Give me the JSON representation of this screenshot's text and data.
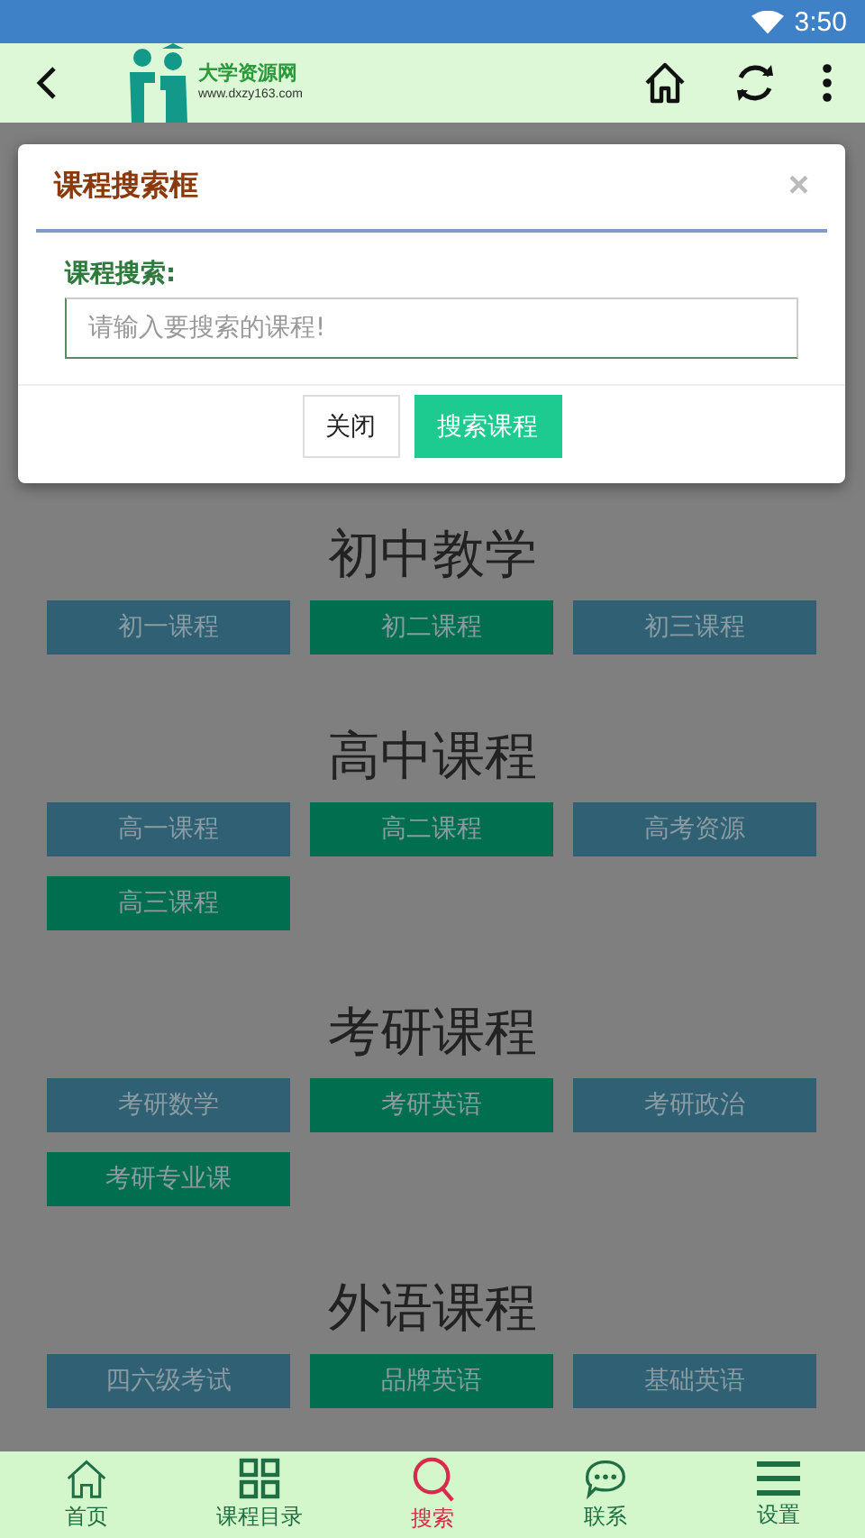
{
  "status_bar": {
    "time": "3:50"
  },
  "app_bar": {
    "logo_title": "大学资源网",
    "logo_url": "www.dxzy163.com"
  },
  "sections": [
    {
      "heading": "初中教学",
      "buttons": [
        {
          "label": "初一课程",
          "color": "#2f6073"
        },
        {
          "label": "初二课程",
          "color": "#006e4f"
        },
        {
          "label": "初三课程",
          "color": "#2f6073"
        }
      ]
    },
    {
      "heading": "高中课程",
      "buttons": [
        {
          "label": "高一课程",
          "color": "#2f6073"
        },
        {
          "label": "高二课程",
          "color": "#006e4f"
        },
        {
          "label": "高考资源",
          "color": "#2f6073"
        },
        {
          "label": "高三课程",
          "color": "#006e4f"
        }
      ]
    },
    {
      "heading": "考研课程",
      "buttons": [
        {
          "label": "考研数学",
          "color": "#2f6073"
        },
        {
          "label": "考研英语",
          "color": "#006e4f"
        },
        {
          "label": "考研政治",
          "color": "#2f6073"
        },
        {
          "label": "考研专业课",
          "color": "#006e4f"
        }
      ]
    },
    {
      "heading": "外语课程",
      "buttons": [
        {
          "label": "四六级考试",
          "color": "#2f6073"
        },
        {
          "label": "品牌英语",
          "color": "#006e4f"
        },
        {
          "label": "基础英语",
          "color": "#2f6073"
        }
      ]
    }
  ],
  "dialog": {
    "title": "课程搜索框",
    "close": "×",
    "field_label": "课程搜索:",
    "placeholder": "请输入要搜索的课程!",
    "buttons": [
      {
        "label": "关闭",
        "kind": "secondary"
      },
      {
        "label": "搜索课程",
        "kind": "primary"
      }
    ]
  },
  "bottom_nav": [
    {
      "label": "首页",
      "selected": false
    },
    {
      "label": "课程目录",
      "selected": false
    },
    {
      "label": "搜索",
      "selected": true
    },
    {
      "label": "联系",
      "selected": false
    },
    {
      "label": "设置",
      "selected": false
    }
  ]
}
